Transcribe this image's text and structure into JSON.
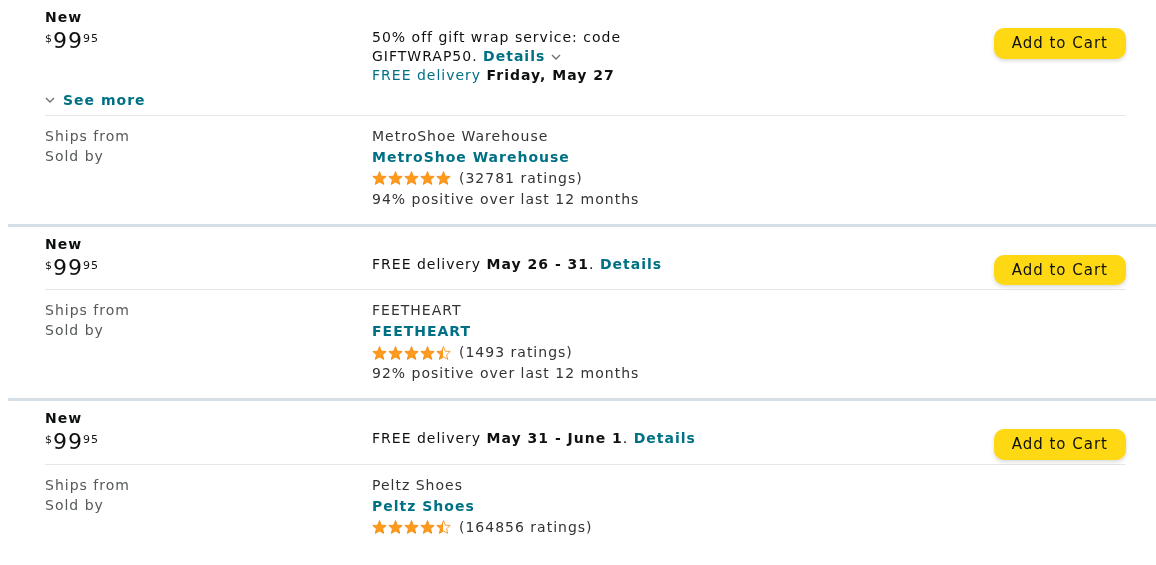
{
  "offers": [
    {
      "condition": "New",
      "price": {
        "symbol": "$",
        "whole": "99",
        "fraction": "95"
      },
      "see_more": "See more",
      "promo": {
        "text": "50% off gift wrap service: code GIFTWRAP50.",
        "link": "Details",
        "caret": true
      },
      "delivery": {
        "lead": "FREE delivery",
        "highlighted": true,
        "text": "**Friday, May 27**"
      },
      "button": "Add to Cart",
      "ships_from_label": "Ships from",
      "ships_from": "MetroShoe Warehouse",
      "sold_by_label": "Sold by",
      "sold_by": "MetroShoe Warehouse",
      "stars": 5,
      "ratings": "(32781 ratings)",
      "positive": "94% positive over last 12 months"
    },
    {
      "condition": "New",
      "price": {
        "symbol": "$",
        "whole": "99",
        "fraction": "95"
      },
      "delivery": {
        "lead": "FREE delivery",
        "highlighted": false,
        "text": "**May 26 - 31**.",
        "link": "Details"
      },
      "button": "Add to Cart",
      "ships_from_label": "Ships from",
      "ships_from": "FEETHEART",
      "sold_by_label": "Sold by",
      "sold_by": "FEETHEART",
      "stars": 4.5,
      "ratings": "(1493 ratings)",
      "positive": "92% positive over last 12 months"
    },
    {
      "condition": "New",
      "price": {
        "symbol": "$",
        "whole": "99",
        "fraction": "95"
      },
      "delivery": {
        "lead": "FREE delivery",
        "highlighted": false,
        "text": "**May 31 - June 1**.",
        "link": "Details"
      },
      "button": "Add to Cart",
      "ships_from_label": "Ships from",
      "ships_from": "Peltz Shoes",
      "sold_by_label": "Sold by",
      "sold_by": "Peltz Shoes",
      "stars": 4.5,
      "ratings": "(164856 ratings)"
    }
  ]
}
